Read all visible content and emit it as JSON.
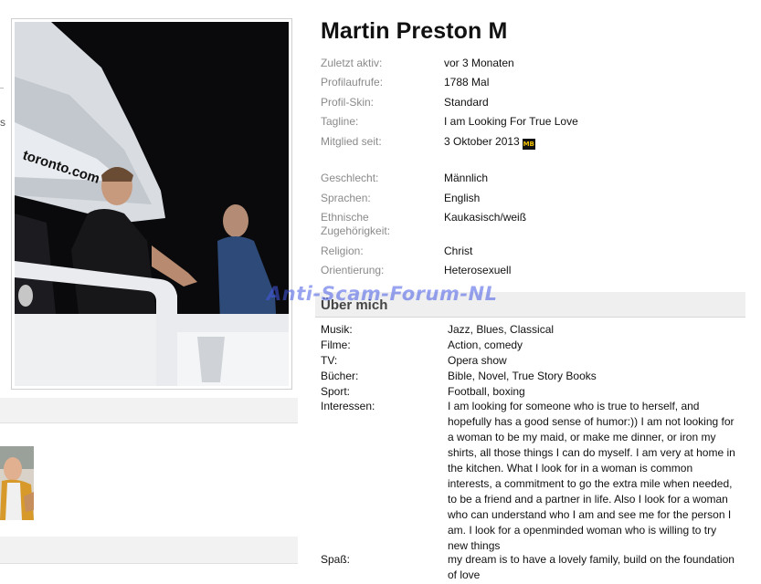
{
  "profile": {
    "name": "Martin Preston M"
  },
  "info": [
    {
      "label": "Zuletzt aktiv:",
      "value": "vor 3 Monaten"
    },
    {
      "label": "Profilaufrufe:",
      "value": "1788 Mal"
    },
    {
      "label": "Profil-Skin:",
      "value": "Standard"
    },
    {
      "label": "Tagline:",
      "value": "I am Looking For True Love"
    },
    {
      "label": "Mitglied seit:",
      "value": "3 Oktober 2013"
    },
    {
      "label": "Geschlecht:",
      "value": "Männlich"
    },
    {
      "label": "Sprachen:",
      "value": "English"
    },
    {
      "label": "Ethnische Zugehörigkeit:",
      "value": "Kaukasisch/weiß"
    },
    {
      "label": "Religion:",
      "value": "Christ"
    },
    {
      "label": "Orientierung:",
      "value": "Heterosexuell"
    }
  ],
  "member_badge": {
    "icon": "member-badge-icon",
    "text": "MB"
  },
  "about": {
    "title": "Über mich",
    "rows": [
      {
        "label": "Musik:",
        "value": "Jazz, Blues, Classical"
      },
      {
        "label": "Filme:",
        "value": "Action, comedy"
      },
      {
        "label": "TV:",
        "value": "Opera show"
      },
      {
        "label": "Bücher:",
        "value": "Bible, Novel, True Story Books"
      },
      {
        "label": "Sport:",
        "value": "Football, boxing"
      },
      {
        "label": "Interessen:",
        "value": "I am looking for someone who is true to herself, and hopefully has a good sense of humor:)) I am not looking for a woman to be my maid, or make me dinner, or iron my shirts, all those things I can do myself. I am very at home in the kitchen. What I look for in a woman is common interests, a commitment to go the extra mile when needed, to be a friend and a partner in life. Also I look for a woman who can understand who I am and see me for the person I am. I look for a openminded woman who is willing to try new things"
      },
      {
        "label": "Spaß:",
        "value": "my dream is to have a lovely family, build on the foundation of love"
      }
    ]
  },
  "watermark": "Anti-Scam-Forum-NL",
  "photo": {
    "sign_text": "toronto.com"
  },
  "left_edge_text": "s",
  "colors": {
    "label_grey": "#8a8a8a",
    "section_bg": "#efefef",
    "watermark": "#4a5ae6"
  }
}
